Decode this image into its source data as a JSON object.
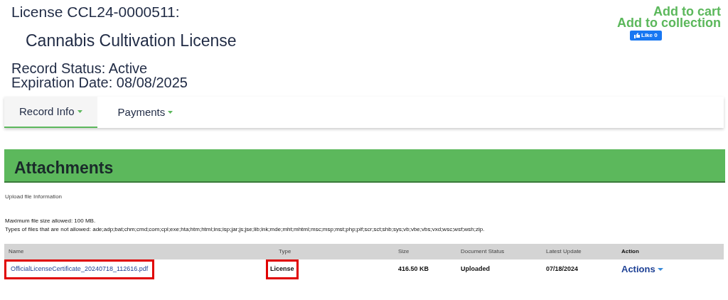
{
  "header": {
    "license": "License CCL24-0000511:",
    "license_type": "Cannabis Cultivation License",
    "status": "Record Status: Active",
    "expiration": "Expiration Date: 08/08/2025"
  },
  "links": [
    "Add to cart",
    "Add to collection"
  ],
  "like_button": {
    "label": "Like 0"
  },
  "tabs": [
    {
      "label": "Record Info",
      "selected": true
    },
    {
      "label": "Payments",
      "selected": false
    }
  ],
  "attachments": {
    "title": "Attachments",
    "upload_info": "Upload file Information",
    "max_size": "Maximum file size allowed: 100 MB.",
    "not_allowed": "Types of files that are not allowed: ade;adp;bat;chm;cmd;com;cpl;exe;hta;htm;html;ins;isp;jar;js;jse;lib;lnk;mde;mht;mhtml;msc;msp;mst;php;pif;scr;sct;shb;sys;vb;vbe;vbs;vxd;wsc;wsf;wsh;zip.",
    "columns": [
      "Name",
      "Type",
      "Size",
      "Document Status",
      "Latest Update",
      "Action"
    ],
    "rows": [
      {
        "cells": [
          {
            "text": "OfficialLicenseCertificate_20240718_112616.pdf",
            "highlighted": true
          },
          {
            "text": "License",
            "highlighted": true
          },
          {
            "text": "416.50 KB",
            "highlighted": false
          },
          {
            "text": "Uploaded",
            "highlighted": false
          },
          {
            "text": "07/18/2024",
            "highlighted": false
          },
          {
            "text": "Actions",
            "highlighted": false
          }
        ]
      }
    ]
  }
}
